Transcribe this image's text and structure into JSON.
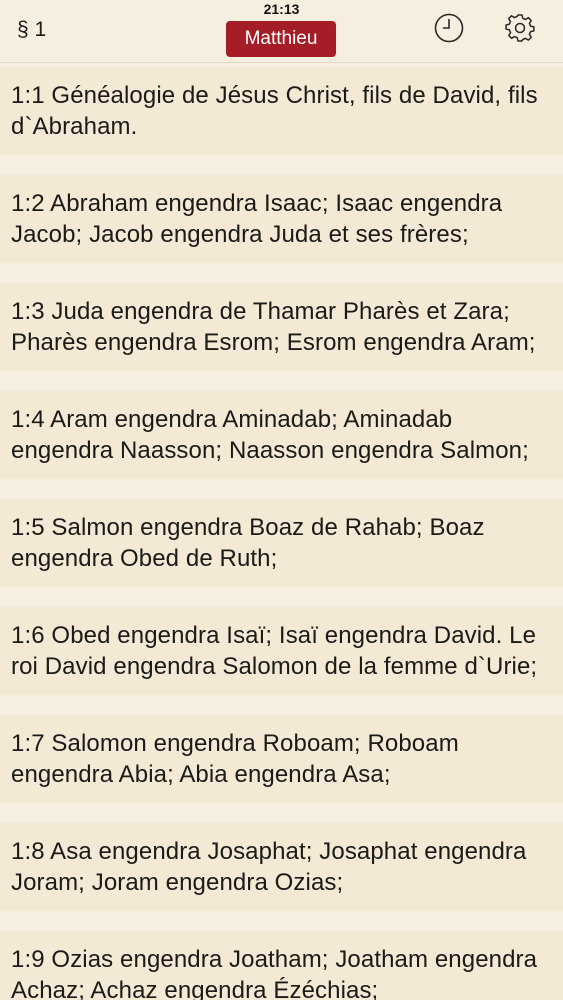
{
  "status": {
    "time": "21:13"
  },
  "header": {
    "chapter_label": "§ 1",
    "book_label": "Matthieu",
    "history_icon": "clock-icon",
    "settings_icon": "gear-icon"
  },
  "colors": {
    "background": "#f6efdf",
    "verse_background": "#f3e9d4",
    "accent": "#a51d26"
  },
  "verses": [
    "1:1 Généalogie de Jésus Christ, fils de David, fils d`Abraham.",
    "1:2 Abraham engendra Isaac; Isaac engendra Jacob; Jacob engendra Juda et ses frères;",
    "1:3 Juda engendra de Thamar Pharès et Zara; Pharès engendra Esrom; Esrom engendra Aram;",
    "1:4 Aram engendra Aminadab; Aminadab engendra Naasson; Naasson engendra Salmon;",
    "1:5 Salmon engendra Boaz de Rahab; Boaz engendra Obed de Ruth;",
    "1:6 Obed engendra Isaï; Isaï engendra David. Le roi David engendra Salomon de la femme d`Urie;",
    "1:7 Salomon engendra Roboam; Roboam engendra Abia; Abia engendra Asa;",
    "1:8 Asa engendra Josaphat; Josaphat engendra Joram; Joram engendra Ozias;",
    "1:9 Ozias engendra Joatham; Joatham engendra Achaz; Achaz engendra Ézéchias;"
  ]
}
